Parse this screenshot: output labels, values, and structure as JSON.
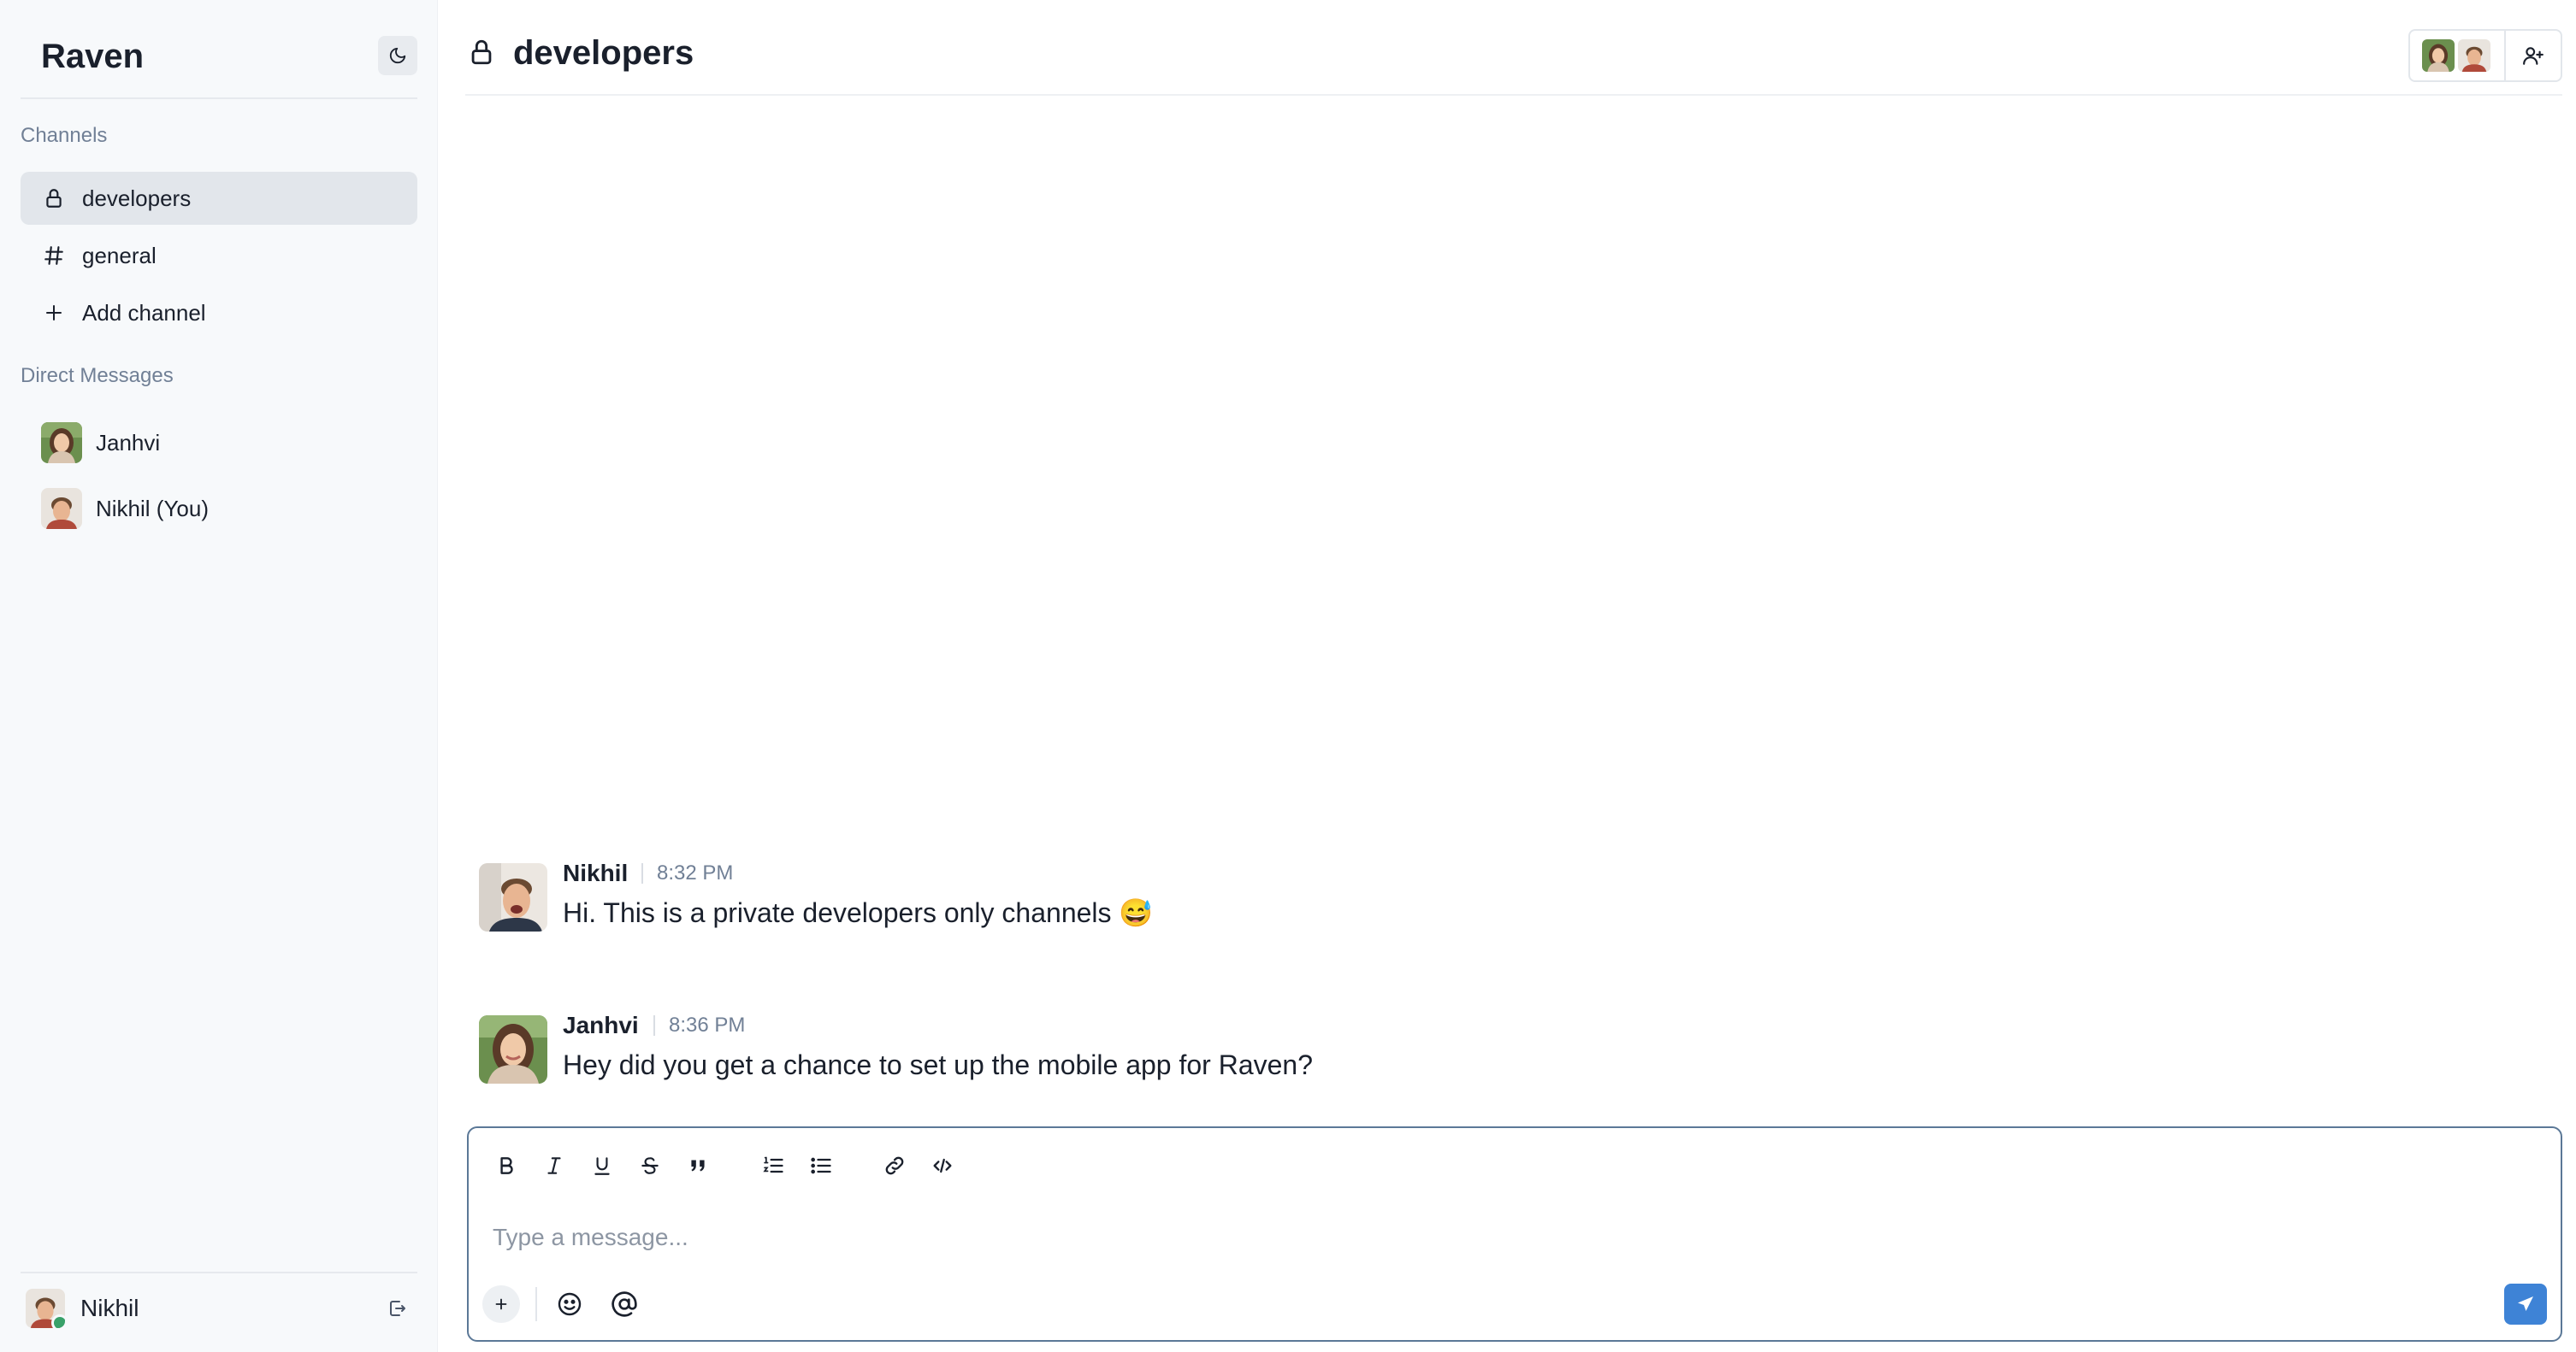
{
  "app": {
    "title": "Raven"
  },
  "sidebar": {
    "theme_toggle_icon": "moon-icon",
    "channels_title": "Channels",
    "channels": [
      {
        "label": "developers",
        "icon": "lock-icon",
        "active": true
      },
      {
        "label": "general",
        "icon": "hash-icon",
        "active": false
      }
    ],
    "add_channel_label": "Add channel",
    "direct_messages_title": "Direct Messages",
    "direct_messages": [
      {
        "label": "Janhvi"
      },
      {
        "label": "Nikhil (You)"
      }
    ],
    "current_user": {
      "name": "Nikhil",
      "status_color": "#38a169"
    }
  },
  "header": {
    "channel_name": "developers",
    "channel_icon": "lock-icon"
  },
  "messages": [
    {
      "author": "Nikhil",
      "time": "8:32 PM",
      "text": "Hi. This is a private developers only channels 😅"
    },
    {
      "author": "Janhvi",
      "time": "8:36 PM",
      "text": "Hey did you get a chance to set up the mobile app for Raven?"
    }
  ],
  "composer": {
    "placeholder": "Type a message...",
    "toolbar": [
      "bold-icon",
      "italic-icon",
      "underline-icon",
      "strikethrough-icon",
      "quote-icon",
      "ordered-list-icon",
      "bullet-list-icon",
      "link-icon",
      "code-icon"
    ],
    "send_color": "#3e83d6"
  },
  "colors": {
    "accent": "#3e83d6",
    "sidebar_bg": "#f7f9fb",
    "active_item_bg": "#e2e6eb"
  }
}
